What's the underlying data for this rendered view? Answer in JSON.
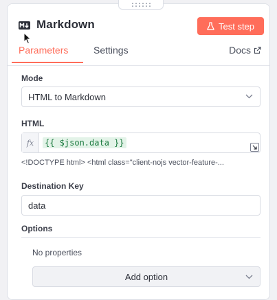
{
  "header": {
    "title": "Markdown",
    "test_button_label": "Test step",
    "icon": "markdown-icon"
  },
  "tabs": [
    {
      "label": "Parameters",
      "active": true
    },
    {
      "label": "Settings",
      "active": false
    }
  ],
  "docs_label": "Docs",
  "mode": {
    "label": "Mode",
    "value": "HTML to Markdown"
  },
  "html": {
    "label": "HTML",
    "fx_label": "fx",
    "expression": "{{ $json.data }}",
    "preview": "<!DOCTYPE html> <html class=\"client-nojs vector-feature-..."
  },
  "destination_key": {
    "label": "Destination Key",
    "value": "data"
  },
  "options": {
    "label": "Options",
    "empty_text": "No properties",
    "add_option_label": "Add option"
  },
  "colors": {
    "accent": "#ff6d5a",
    "expression_text": "#1b7a3f",
    "expression_bg": "#e3f3e8"
  }
}
